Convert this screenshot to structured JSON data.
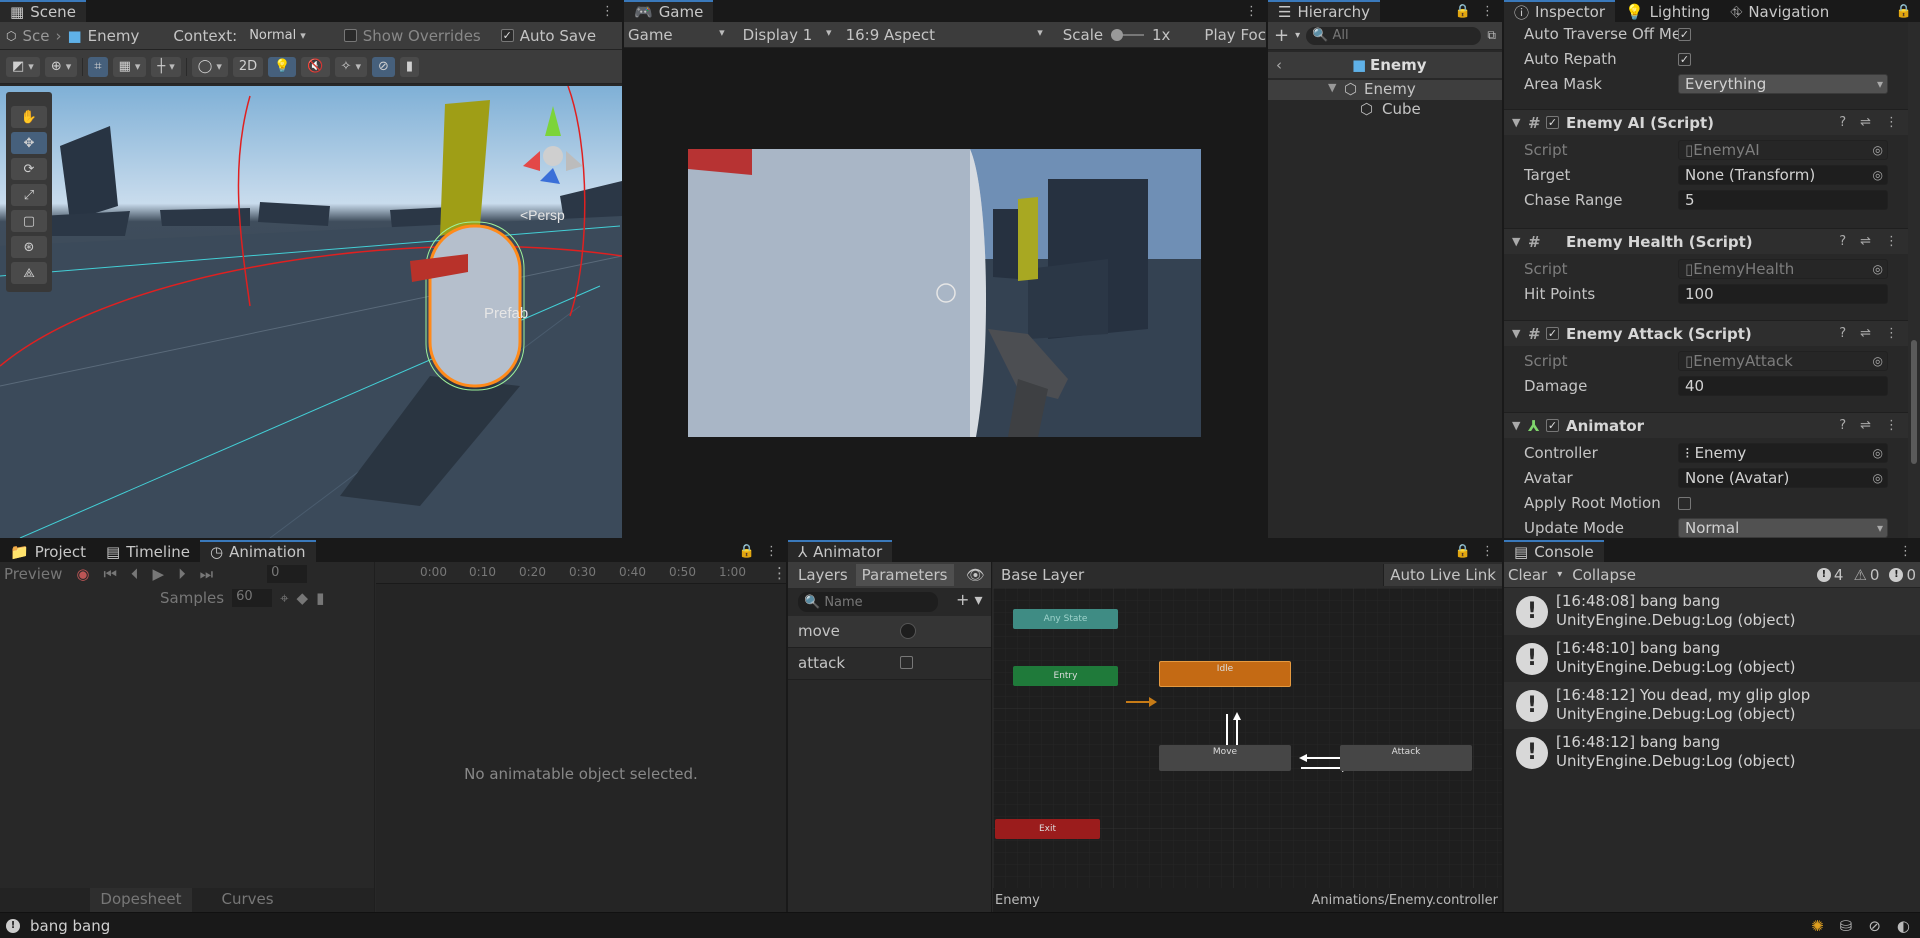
{
  "scene": {
    "tab_label": "Scene",
    "breadcrumb_short": "Sce",
    "object_name": "Enemy",
    "context_label": "Context:",
    "context_value": "Normal",
    "show_overrides": "Show Overrides",
    "auto_save": "Auto Save",
    "mode_2d": "2D",
    "persp_label": "<Persp",
    "prefab_label": "Prefab"
  },
  "game": {
    "tab_label": "Game",
    "view_select": "Game",
    "display_select": "Display 1",
    "aspect_select": "16:9 Aspect",
    "scale_label": "Scale",
    "scale_value": "1x",
    "play_focus": "Play Foc"
  },
  "hierarchy": {
    "tab_label": "Hierarchy",
    "search_placeholder": "All",
    "prefab_root": "Enemy",
    "items": [
      "Enemy",
      "Cube"
    ]
  },
  "inspector": {
    "tabs": [
      "Inspector",
      "Lighting",
      "Navigation"
    ],
    "nav_agent": {
      "auto_traverse_label": "Auto Traverse Off Me",
      "auto_repath_label": "Auto Repath",
      "area_mask_label": "Area Mask",
      "area_mask_value": "Everything"
    },
    "enemy_ai": {
      "title": "Enemy AI (Script)",
      "script_label": "Script",
      "script_value": "EnemyAI",
      "target_label": "Target",
      "target_value": "None (Transform)",
      "chase_label": "Chase Range",
      "chase_value": "5"
    },
    "enemy_health": {
      "title": "Enemy Health (Script)",
      "script_label": "Script",
      "script_value": "EnemyHealth",
      "hp_label": "Hit Points",
      "hp_value": "100"
    },
    "enemy_attack": {
      "title": "Enemy Attack (Script)",
      "script_label": "Script",
      "script_value": "EnemyAttack",
      "damage_label": "Damage",
      "damage_value": "40"
    },
    "animator": {
      "title": "Animator",
      "controller_label": "Controller",
      "controller_value": "Enemy",
      "avatar_label": "Avatar",
      "avatar_value": "None (Avatar)",
      "root_motion_label": "Apply Root Motion",
      "update_mode_label": "Update Mode",
      "update_mode_value": "Normal"
    }
  },
  "bottom_left": {
    "tabs": [
      "Project",
      "Timeline",
      "Animation"
    ],
    "preview_label": "Preview",
    "frame_value": "0",
    "samples_label": "Samples",
    "samples_value": "60",
    "ruler_ticks": [
      "0:00",
      "0:10",
      "0:20",
      "0:30",
      "0:40",
      "0:50",
      "1:00"
    ],
    "empty_message": "No animatable object selected.",
    "footer_tabs": [
      "Dopesheet",
      "Curves"
    ]
  },
  "animator_window": {
    "tab_label": "Animator",
    "layers_tab": "Layers",
    "parameters_tab": "Parameters",
    "base_layer": "Base Layer",
    "auto_live_link": "Auto Live Link",
    "name_placeholder": "Name",
    "parameters": [
      {
        "name": "move",
        "type": "trigger"
      },
      {
        "name": "attack",
        "type": "bool"
      }
    ],
    "states": {
      "any": "Any State",
      "entry": "Entry",
      "idle": "Idle",
      "move": "Move",
      "attack": "Attack",
      "exit": "Exit"
    },
    "footer_left": "Enemy",
    "footer_right": "Animations/Enemy.controller"
  },
  "console": {
    "tab_label": "Console",
    "clear": "Clear",
    "collapse": "Collapse",
    "count_logs": "4",
    "count_warnings": "0",
    "count_errors": "0",
    "entries": [
      {
        "line1": "[16:48:08] bang bang",
        "line2": "UnityEngine.Debug:Log (object)"
      },
      {
        "line1": "[16:48:10] bang bang",
        "line2": "UnityEngine.Debug:Log (object)"
      },
      {
        "line1": "[16:48:12] You dead, my glip glop",
        "line2": "UnityEngine.Debug:Log (object)"
      },
      {
        "line1": "[16:48:12] bang bang",
        "line2": "UnityEngine.Debug:Log (object)"
      }
    ]
  },
  "status_bar": {
    "message": "bang bang"
  },
  "colors": {
    "accent": "#3a79bb",
    "entry_state": "#1f7a3a",
    "idle_state": "#c46a14",
    "exit_state": "#9b1c1c",
    "any_state": "#3f8c84"
  }
}
